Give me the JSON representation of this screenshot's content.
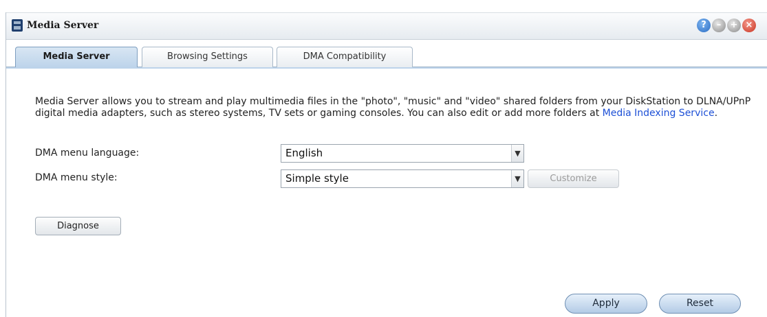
{
  "window": {
    "title": "Media Server"
  },
  "window_buttons": {
    "help": "?",
    "minimize": "–",
    "maximize": "+",
    "close": "×"
  },
  "tabs": [
    {
      "label": "Media Server",
      "active": true
    },
    {
      "label": "Browsing Settings",
      "active": false
    },
    {
      "label": "DMA Compatibility",
      "active": false
    }
  ],
  "description": {
    "text": "Media Server allows you to stream and play multimedia files in the \"photo\", \"music\" and \"video\" shared folders from your DiskStation to DLNA/UPnP digital media adapters, such as stereo systems, TV sets or gaming consoles. You can also edit or add more folders at ",
    "link": "Media Indexing Service",
    "suffix": "."
  },
  "form": {
    "language_label": "DMA menu language:",
    "language_value": "English",
    "style_label": "DMA menu style:",
    "style_value": "Simple style",
    "customize_label": "Customize"
  },
  "buttons": {
    "diagnose": "Diagnose",
    "apply": "Apply",
    "reset": "Reset"
  },
  "icons": {
    "dropdown_arrow": "chevron-down-icon",
    "app": "media-server-icon"
  },
  "colors": {
    "link": "#1c4fd6",
    "tab_active": "#bcd3ea",
    "close": "#c8321f",
    "help": "#2a6cc4"
  }
}
